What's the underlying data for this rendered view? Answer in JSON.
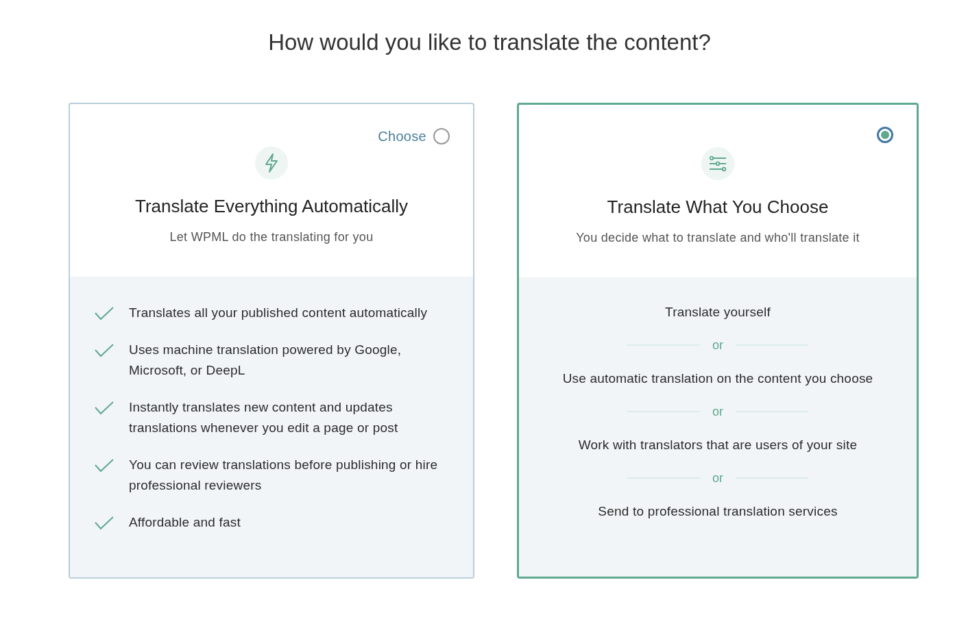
{
  "heading": "How would you like to translate the content?",
  "options": [
    {
      "kind": "features",
      "selected": false,
      "choose_label": "Choose",
      "title": "Translate Everything Automatically",
      "subtitle": "Let WPML do the translating for you",
      "items": [
        "Translates all your published content automatically",
        "Uses machine translation powered by Google, Microsoft, or DeepL",
        "Instantly translates new content and updates translations whenever you edit a page or post",
        "You can review translations before publishing or hire professional reviewers",
        "Affordable and fast"
      ]
    },
    {
      "kind": "methods",
      "selected": true,
      "title": "Translate What You Choose",
      "subtitle": "You decide what to translate and who'll translate it",
      "items": [
        "Translate yourself",
        "Use automatic translation on the content you choose",
        "Work with translators that are users of your site",
        "Send to professional translation services"
      ],
      "separators": [
        "or",
        "or",
        "or"
      ]
    }
  ]
}
